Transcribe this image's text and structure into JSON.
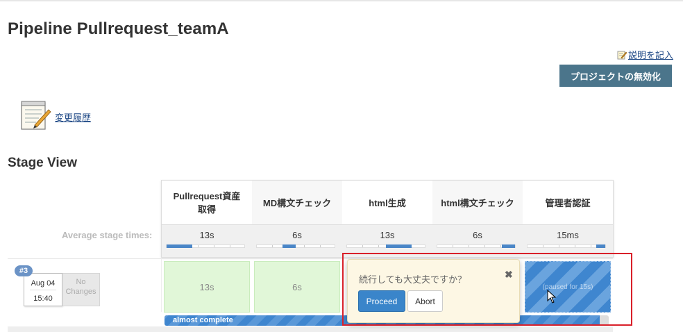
{
  "page": {
    "title": "Pipeline Pullrequest_teamA",
    "edit_description": "説明を記入",
    "disable_button": "プロジェクトの無効化",
    "changes_link": "変更履歴",
    "section_title": "Stage View"
  },
  "stage_view": {
    "average_label": "Average stage times:",
    "stages": [
      {
        "name": "Pullrequest資産取得",
        "avg": "13s",
        "fill_fraction": 0.33
      },
      {
        "name": "MD構文チェック",
        "avg": "6s",
        "fill_fraction": 0.17
      },
      {
        "name": "html生成",
        "avg": "13s",
        "fill_fraction": 0.33
      },
      {
        "name": "html構文チェック",
        "avg": "6s",
        "fill_fraction": 0.17
      },
      {
        "name": "管理者認証",
        "avg": "15ms",
        "fill_fraction": 0
      }
    ],
    "build": {
      "number": "#3",
      "date": "Aug 04",
      "time": "15:40",
      "changes": "No Changes",
      "cells": [
        "13s",
        "6s"
      ],
      "paused_text": "(paused for 15s)",
      "progress_label": "almost complete",
      "progress_fraction": 0.98
    }
  },
  "popup": {
    "question": "続行しても大丈夫ですか？",
    "proceed": "Proceed",
    "abort": "Abort",
    "close_icon": "close-icon"
  },
  "colors": {
    "disable_button_bg": "#4b758b",
    "success_cell": "#e1f7d8",
    "progress_blue": "#3f86cf",
    "highlight_red": "#d9202a"
  }
}
